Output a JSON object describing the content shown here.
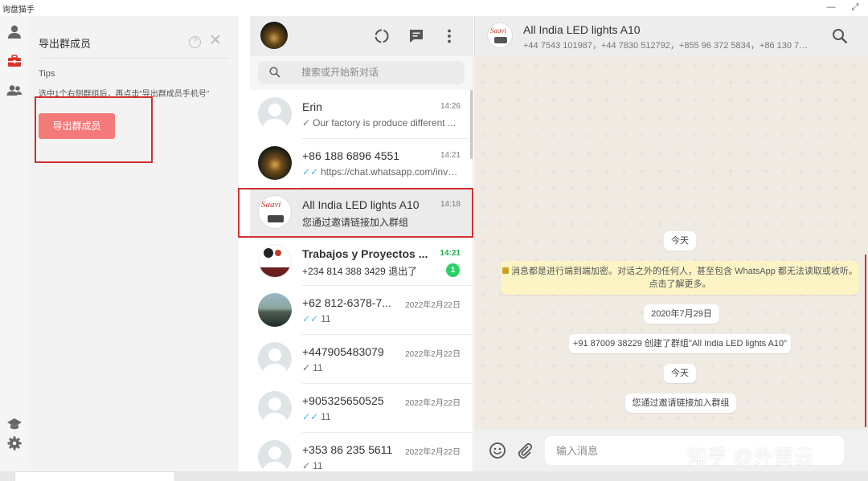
{
  "app": {
    "title": "询盘猫手",
    "window_controls": [
      "—",
      "⤢"
    ]
  },
  "rail": {
    "icons": [
      "user-icon",
      "toolbox-icon",
      "group-icon",
      "graduation-cap-icon",
      "gear-icon"
    ]
  },
  "tool_panel": {
    "title": "导出群成员",
    "help_label": "?",
    "close_label": "✕",
    "tips_title": "Tips",
    "tips_text": "选中1个右侧群组后，再点击“导出群成员手机号”",
    "export_button": "导出群成员"
  },
  "chat_list": {
    "search_placeholder": "搜索或开始新对话",
    "items": [
      {
        "name": "Erin",
        "time": "14:26",
        "preview": "Our factory is produce different ...",
        "tick": "✓",
        "tick_color": "grey",
        "avatar": "default"
      },
      {
        "name": "+86 188 6896 4551",
        "time": "14:21",
        "preview": "https://chat.whatsapp.com/invit...",
        "tick": "✓✓",
        "tick_color": "blue",
        "avatar": "photo-night"
      },
      {
        "name": "All India LED lights A10",
        "time": "14:18",
        "preview": "您通过邀请链接加入群组",
        "tick": "",
        "tick_color": "",
        "avatar": "saavi-logo",
        "selected": true
      },
      {
        "name": "Trabajos y Proyectos ...",
        "time": "14:21",
        "preview": "+234 814 388 3429 退出了",
        "tick": "",
        "tick_color": "",
        "avatar": "group-logo",
        "unread": "1",
        "bold": true
      },
      {
        "name": "+62 812-6378-7...",
        "time": "2022年2月22日",
        "preview": "11",
        "tick": "✓✓",
        "tick_color": "blue",
        "avatar": "photo-building"
      },
      {
        "name": "+447905483079",
        "time": "2022年2月22日",
        "preview": "11",
        "tick": "✓",
        "tick_color": "grey",
        "avatar": "default"
      },
      {
        "name": "+905325650525",
        "time": "2022年2月22日",
        "preview": "11",
        "tick": "✓✓",
        "tick_color": "blue",
        "avatar": "default"
      },
      {
        "name": "+353 86 235 5611",
        "time": "2022年2月22日",
        "preview": "11",
        "tick": "✓",
        "tick_color": "grey",
        "avatar": "default"
      }
    ]
  },
  "conversation": {
    "group_name": "All India LED lights A10",
    "avatar_text": "Saavi",
    "members": "+44 7543 101987，+44 7830 512792，+855 96 372 5834，+86 130 781...",
    "messages": {
      "date_today_1": "今天",
      "encryption_line1": "消息都是进行端到端加密。对话之外的任何人，甚至包含 WhatsApp 都无法读取或收听。",
      "encryption_line2": "点击了解更多。",
      "date_2020": "2020年7月29日",
      "created_group": "+91 87009 38229 创建了群组\"All India LED lights A10\"",
      "date_today_2": "今天",
      "joined": "您通过邀请链接加入群组"
    },
    "input_placeholder": "输入消息",
    "watermark": "知乎 @外贸云"
  },
  "colors": {
    "accent_red": "#f47a7a",
    "highlight_red": "#d32f2f",
    "unread_green": "#25d366",
    "read_blue": "#4fb8e8"
  }
}
